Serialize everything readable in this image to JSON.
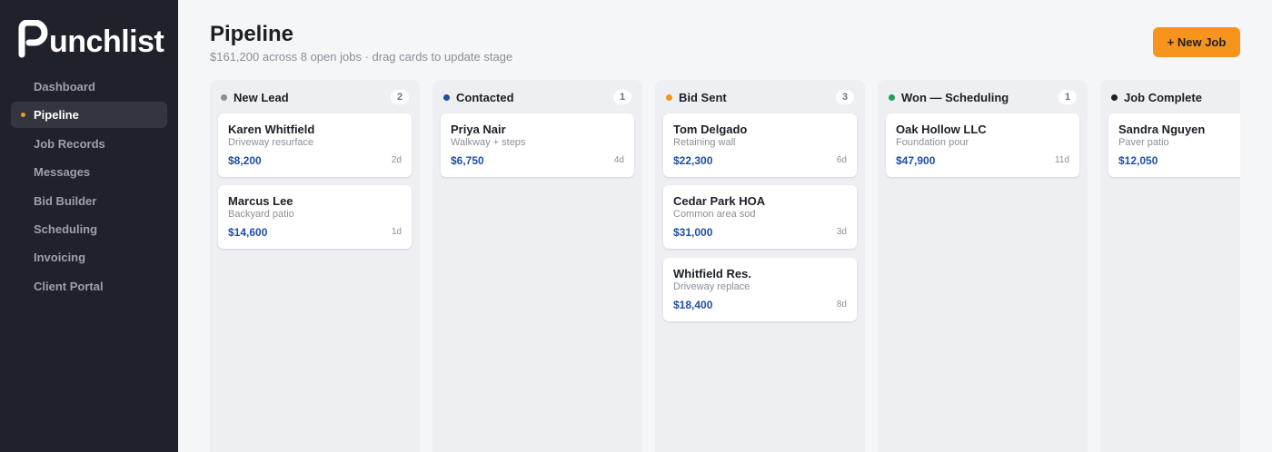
{
  "brand": {
    "name": "unchlist"
  },
  "sidebar": {
    "items": [
      {
        "label": "Dashboard",
        "active": false
      },
      {
        "label": "Pipeline",
        "active": true
      },
      {
        "label": "Job Records",
        "active": false
      },
      {
        "label": "Messages",
        "active": false
      },
      {
        "label": "Bid Builder",
        "active": false
      },
      {
        "label": "Scheduling",
        "active": false
      },
      {
        "label": "Invoicing",
        "active": false
      },
      {
        "label": "Client Portal",
        "active": false
      }
    ]
  },
  "header": {
    "title": "Pipeline",
    "subtitle": "$161,200 across 8 open jobs · drag cards to update stage",
    "new_job_label": "+ New Job"
  },
  "colors": {
    "accent": "#f7941d",
    "amount": "#1f4fa0",
    "sidebar_bg": "#1f222a"
  },
  "columns": [
    {
      "title": "New Lead",
      "count": "2",
      "dot_color": "#8a8f98",
      "cards": [
        {
          "name": "Karen Whitfield",
          "desc": "Driveway resurface",
          "amount": "$8,200",
          "age": "2d"
        },
        {
          "name": "Marcus Lee",
          "desc": "Backyard patio",
          "amount": "$14,600",
          "age": "1d"
        }
      ]
    },
    {
      "title": "Contacted",
      "count": "1",
      "dot_color": "#1f4fa0",
      "cards": [
        {
          "name": "Priya Nair",
          "desc": "Walkway + steps",
          "amount": "$6,750",
          "age": "4d"
        }
      ]
    },
    {
      "title": "Bid Sent",
      "count": "3",
      "dot_color": "#f7941d",
      "cards": [
        {
          "name": "Tom Delgado",
          "desc": "Retaining wall",
          "amount": "$22,300",
          "age": "6d"
        },
        {
          "name": "Cedar Park HOA",
          "desc": "Common area sod",
          "amount": "$31,000",
          "age": "3d"
        },
        {
          "name": "Whitfield Res.",
          "desc": "Driveway replace",
          "amount": "$18,400",
          "age": "8d"
        }
      ]
    },
    {
      "title": "Won — Scheduling",
      "count": "1",
      "dot_color": "#1e9e5a",
      "cards": [
        {
          "name": "Oak Hollow LLC",
          "desc": "Foundation pour",
          "amount": "$47,900",
          "age": "11d"
        }
      ]
    },
    {
      "title": "Job Complete",
      "count": "",
      "dot_color": "#1c1f26",
      "cards": [
        {
          "name": "Sandra Nguyen",
          "desc": "Paver patio",
          "amount": "$12,050",
          "age": ""
        }
      ]
    }
  ]
}
